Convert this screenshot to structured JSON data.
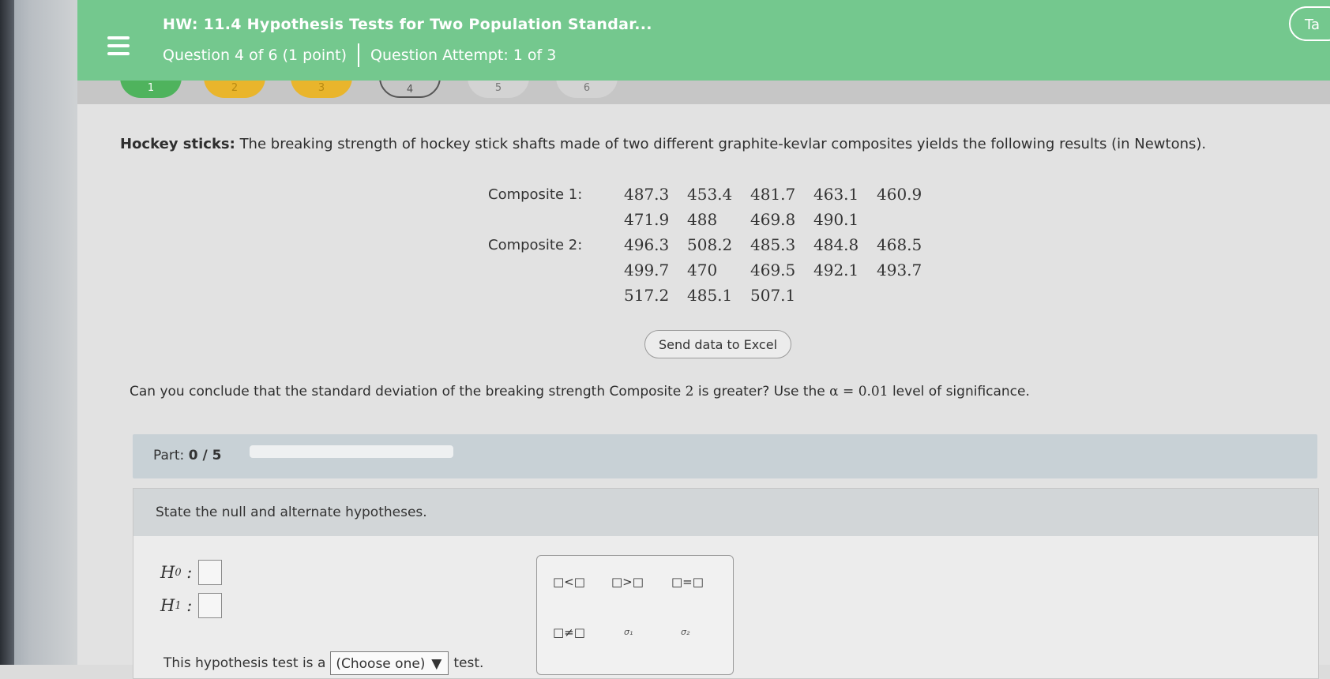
{
  "header": {
    "hw_title": "HW: 11.4 Hypothesis Tests for Two Population Standar...",
    "question_info": "Question 4 of 6 (1 point)",
    "attempt": "Question Attempt: 1 of 3",
    "tab_label": "Ta"
  },
  "pills": [
    "1",
    "2",
    "3",
    "4",
    "5",
    "6"
  ],
  "problem": {
    "bold": "Hockey sticks:",
    "text": " The breaking strength of hockey stick shafts made of two different graphite-kevlar composites yields the following results (in Newtons)."
  },
  "data": {
    "rows": [
      {
        "label": "Composite 1:",
        "values": [
          "487.3",
          "453.4",
          "481.7",
          "463.1",
          "460.9"
        ]
      },
      {
        "label": "",
        "values": [
          "471.9",
          "488",
          "469.8",
          "490.1",
          ""
        ]
      },
      {
        "label": "Composite 2:",
        "values": [
          "496.3",
          "508.2",
          "485.3",
          "484.8",
          "468.5"
        ]
      },
      {
        "label": "",
        "values": [
          "499.7",
          "470",
          "469.5",
          "492.1",
          "493.7"
        ]
      },
      {
        "label": "",
        "values": [
          "517.2",
          "485.1",
          "507.1",
          "",
          ""
        ]
      }
    ]
  },
  "excel_button": "Send data to Excel",
  "question": {
    "before": "Can you conclude that the standard deviation of the breaking strength Composite ",
    "num": "2",
    "mid": " is greater? Use the ",
    "alpha": "α = 0.01",
    "after": " level of significance."
  },
  "part": {
    "label": "Part:",
    "value": "0 / 5",
    "progress": 0
  },
  "panel": {
    "heading": "State the null and alternate hypotheses.",
    "h0": "H",
    "h0_sub": "0",
    "h1": "H",
    "h1_sub": "1",
    "palette": {
      "lt": "□<□",
      "gt": "□>□",
      "eq": "□=□",
      "ne": "□≠□",
      "sigma1": "σ₁",
      "sigma2": "σ₂"
    },
    "sentence_before": "This hypothesis test is a",
    "select_value": "(Choose one)",
    "sentence_after": "test."
  }
}
